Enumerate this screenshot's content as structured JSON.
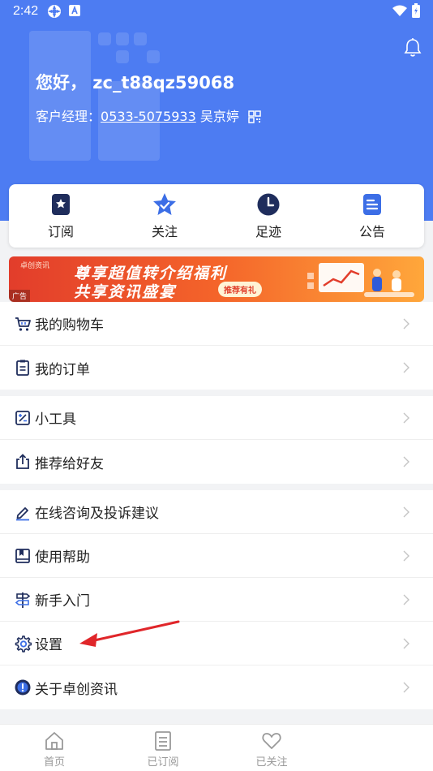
{
  "status_bar": {
    "time": "2:42"
  },
  "header": {
    "greeting": "您好， zc_t88qz59068",
    "manager_prefix": "客户经理：",
    "manager_phone": "0533-5075933",
    "manager_name": "吴京婷"
  },
  "quick_actions": [
    {
      "label": "订阅",
      "icon": "bookmark-icon"
    },
    {
      "label": "关注",
      "icon": "star-badge-icon"
    },
    {
      "label": "足迹",
      "icon": "clock-icon"
    },
    {
      "label": "公告",
      "icon": "document-icon"
    }
  ],
  "banner": {
    "brand": "卓创资讯",
    "line1": "尊享超值转介绍福利",
    "line2": "共享资讯盛宴",
    "tag": "推荐有礼",
    "ad_label": "广告"
  },
  "menu_groups": [
    {
      "items": [
        {
          "label": "我的购物车",
          "icon": "cart-icon"
        },
        {
          "label": "我的订单",
          "icon": "clipboard-icon"
        }
      ]
    },
    {
      "items": [
        {
          "label": "小工具",
          "icon": "tools-icon"
        },
        {
          "label": "推荐给好友",
          "icon": "share-icon"
        }
      ]
    },
    {
      "items": [
        {
          "label": "在线咨询及投诉建议",
          "icon": "pen-icon"
        },
        {
          "label": "使用帮助",
          "icon": "book-icon"
        },
        {
          "label": "新手入门",
          "icon": "signpost-icon"
        },
        {
          "label": "设置",
          "icon": "gear-icon"
        },
        {
          "label": "关于卓创资讯",
          "icon": "info-icon"
        }
      ]
    }
  ],
  "tabbar": [
    {
      "label": "首页",
      "icon": "home-icon"
    },
    {
      "label": "已订阅",
      "icon": "list-icon"
    },
    {
      "label": "已关注",
      "icon": "heart-icon"
    }
  ],
  "colors": {
    "primary": "#4d7cf2",
    "icon_dark": "#1f2d5c",
    "banner_red": "#e23d2b"
  }
}
